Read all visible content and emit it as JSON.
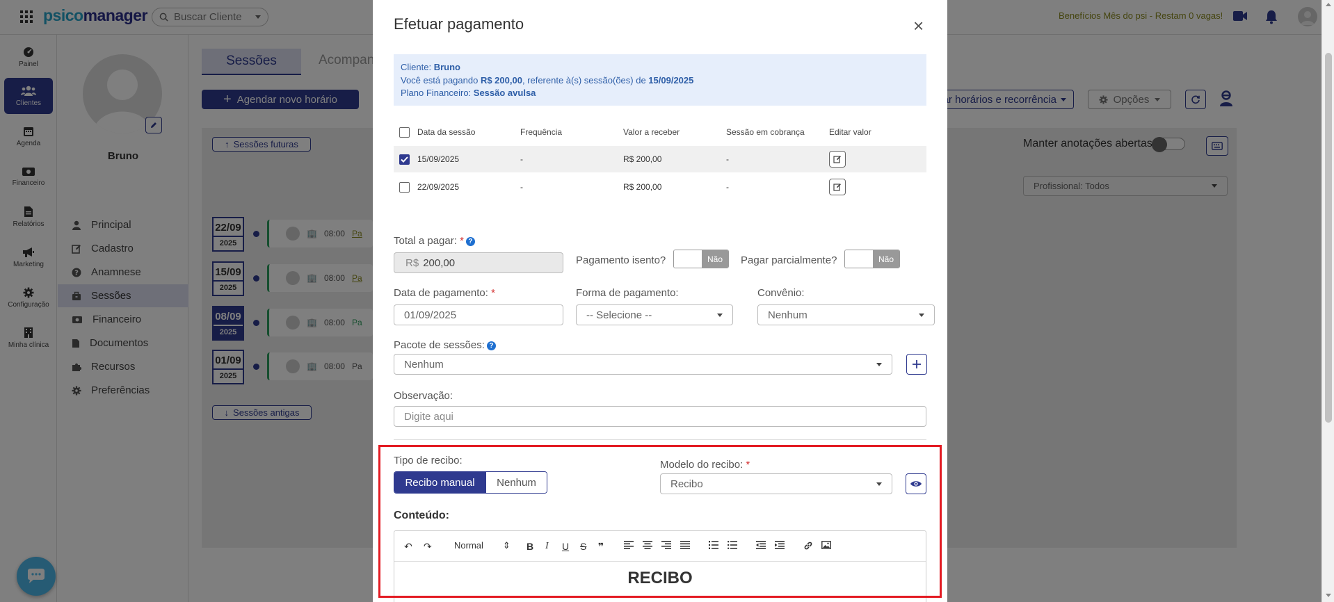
{
  "topbar": {
    "logo_part1": "psico",
    "logo_part2": "manager",
    "search_placeholder": "Buscar Cliente",
    "benefits_text": "Benefícios Mês do psi - Restam 0 vagas!"
  },
  "leftnav": {
    "items": [
      {
        "label": "Painel",
        "icon": "dashboard-icon"
      },
      {
        "label": "Clientes",
        "icon": "users-icon",
        "active": true
      },
      {
        "label": "Agenda",
        "icon": "calendar-icon"
      },
      {
        "label": "Financeiro",
        "icon": "money-icon"
      },
      {
        "label": "Relatórios",
        "icon": "report-icon"
      },
      {
        "label": "Marketing",
        "icon": "megaphone-icon"
      },
      {
        "label": "Configuração",
        "icon": "gear-icon"
      },
      {
        "label": "Minha clínica",
        "icon": "building-icon"
      }
    ]
  },
  "client": {
    "name": "Bruno",
    "menu": [
      {
        "label": "Principal",
        "icon": "user-icon"
      },
      {
        "label": "Cadastro",
        "icon": "edit-icon"
      },
      {
        "label": "Anamnese",
        "icon": "question-icon"
      },
      {
        "label": "Sessões",
        "icon": "briefcase-icon",
        "active": true
      },
      {
        "label": "Financeiro",
        "icon": "money-icon"
      },
      {
        "label": "Documentos",
        "icon": "file-icon"
      },
      {
        "label": "Recursos",
        "icon": "puzzle-icon"
      },
      {
        "label": "Preferências",
        "icon": "gear-icon"
      }
    ]
  },
  "main": {
    "tab_sessoes": "Sessões",
    "tab_acomp": "Acompan",
    "btn_agendar": "Agendar novo horário",
    "btn_horarios": "ar horários e recorrência",
    "btn_opcoes": "Opções",
    "btn_futuras": "Sessões futuras",
    "btn_antigas": "Sessões antigas",
    "manter_label": "Manter anotações abertas",
    "profissional": "Profissional: Todos",
    "sessions": [
      {
        "day": "22/09",
        "year": "2025",
        "time": "08:00",
        "tag": "Pa",
        "dark": false
      },
      {
        "day": "15/09",
        "year": "2025",
        "time": "08:00",
        "tag": "Pa",
        "dark": false
      },
      {
        "day": "08/09",
        "year": "2025",
        "time": "08:00",
        "tag": "Pa",
        "dark": true
      },
      {
        "day": "01/09",
        "year": "2025",
        "time": "08:00",
        "tag": "Pa",
        "dark": false
      }
    ]
  },
  "modal": {
    "title": "Efetuar pagamento",
    "info": {
      "cliente_label": "Cliente: ",
      "cliente": "Bruno",
      "line2_a": "Você está pagando ",
      "amount": "R$ 200,00",
      "line2_b": ", referente à(s) sessão(ões) de ",
      "session_date": "15/09/2025",
      "plano_label": "Plano Financeiro: ",
      "plano": "Sessão avulsa"
    },
    "table": {
      "headers": [
        "Data da sessão",
        "Frequência",
        "Valor a receber",
        "Sessão em cobrança",
        "Editar valor"
      ],
      "rows": [
        {
          "date": "15/09/2025",
          "freq": "-",
          "valor": "R$ 200,00",
          "cobranca": "-",
          "checked": true
        },
        {
          "date": "22/09/2025",
          "freq": "-",
          "valor": "R$ 200,00",
          "cobranca": "-",
          "checked": false
        }
      ]
    },
    "total_label": "Total a pagar:",
    "total_prefix": "R$",
    "total_value": "200,00",
    "isento_label": "Pagamento isento?",
    "isento_value": "Não",
    "parcial_label": "Pagar parcialmente?",
    "parcial_value": "Não",
    "data_label": "Data de pagamento:",
    "data_value": "01/09/2025",
    "forma_label": "Forma de pagamento:",
    "forma_value": "-- Selecione --",
    "convenio_label": "Convênio:",
    "convenio_value": "Nenhum",
    "pacote_label": "Pacote de sessões:",
    "pacote_value": "Nenhum",
    "obs_label": "Observação:",
    "obs_placeholder": "Digite aqui",
    "tipo_label": "Tipo de recibo:",
    "tipo_opt1": "Recibo manual",
    "tipo_opt2": "Nenhum",
    "modelo_label": "Modelo do recibo:",
    "modelo_value": "Recibo",
    "conteudo_label": "Conteúdo:",
    "editor_heading_select": "Normal",
    "editor_content_title": "RECIBO"
  },
  "colors": {
    "primary": "#2f3a8f",
    "accent": "#27a3c9",
    "highlight_border": "#e31b23",
    "success": "#2a9d5c"
  }
}
